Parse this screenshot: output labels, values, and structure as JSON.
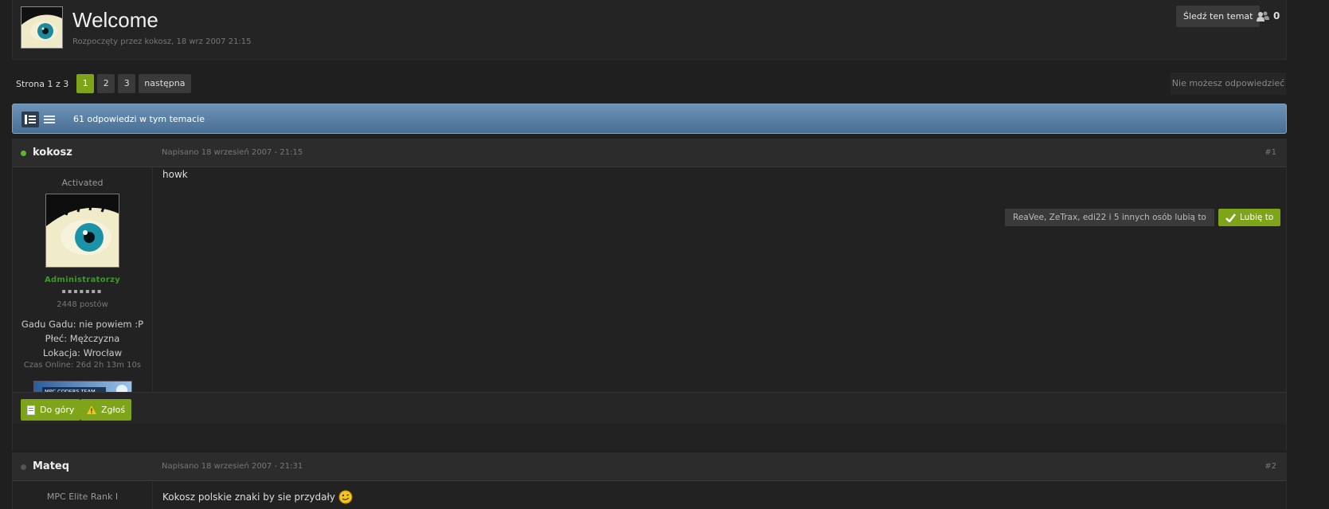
{
  "topic": {
    "title": "Welcome",
    "meta": "Rozpoczęty przez kokosz, 18 wrz 2007 21:15",
    "follow_label": "Śledź ten temat",
    "followers": "0"
  },
  "pagination": {
    "label": "Strona 1 z 3",
    "pages": [
      "1",
      "2",
      "3"
    ],
    "active": "1",
    "next": "następna"
  },
  "reply_notice": "Nie możesz odpowiedzieć",
  "bar": {
    "replies": "61 odpowiedzi w tym temacie"
  },
  "posts": [
    {
      "author": "kokosz",
      "online": true,
      "posted": "Napisano 18 wrzesień 2007 - 21:15",
      "number": "#1",
      "rank": "Activated",
      "group": "Administratorzy",
      "pips": "▪▪▪▪▪▪▪",
      "post_count": "2448 postów",
      "fields": [
        "Gadu Gadu: nie powiem :P",
        "Płeć: Mężczyzna",
        "Lokacja: Wrocław"
      ],
      "online_time": "Czas Online: 26d 2h 13m 10s",
      "badge_text": "MPC CODERS TEAM",
      "body": "howk",
      "likers": "ReaVee, ZeTrax, edi22 i 5 innych osób lubią to",
      "like_label": "Lubię to",
      "top_label": "Do góry",
      "report_label": "Zgłoś"
    },
    {
      "author": "Mateq",
      "online": false,
      "posted": "Napisano 18 wrzesień 2007 - 21:31",
      "number": "#2",
      "rank": "MPC Elite Rank I",
      "body": "Kokosz polskie znaki by sie przydały"
    }
  ],
  "colors": {
    "accent_green": "#7ea41a",
    "bar_blue": "#5b81a6",
    "group_green": "#33a11c"
  }
}
